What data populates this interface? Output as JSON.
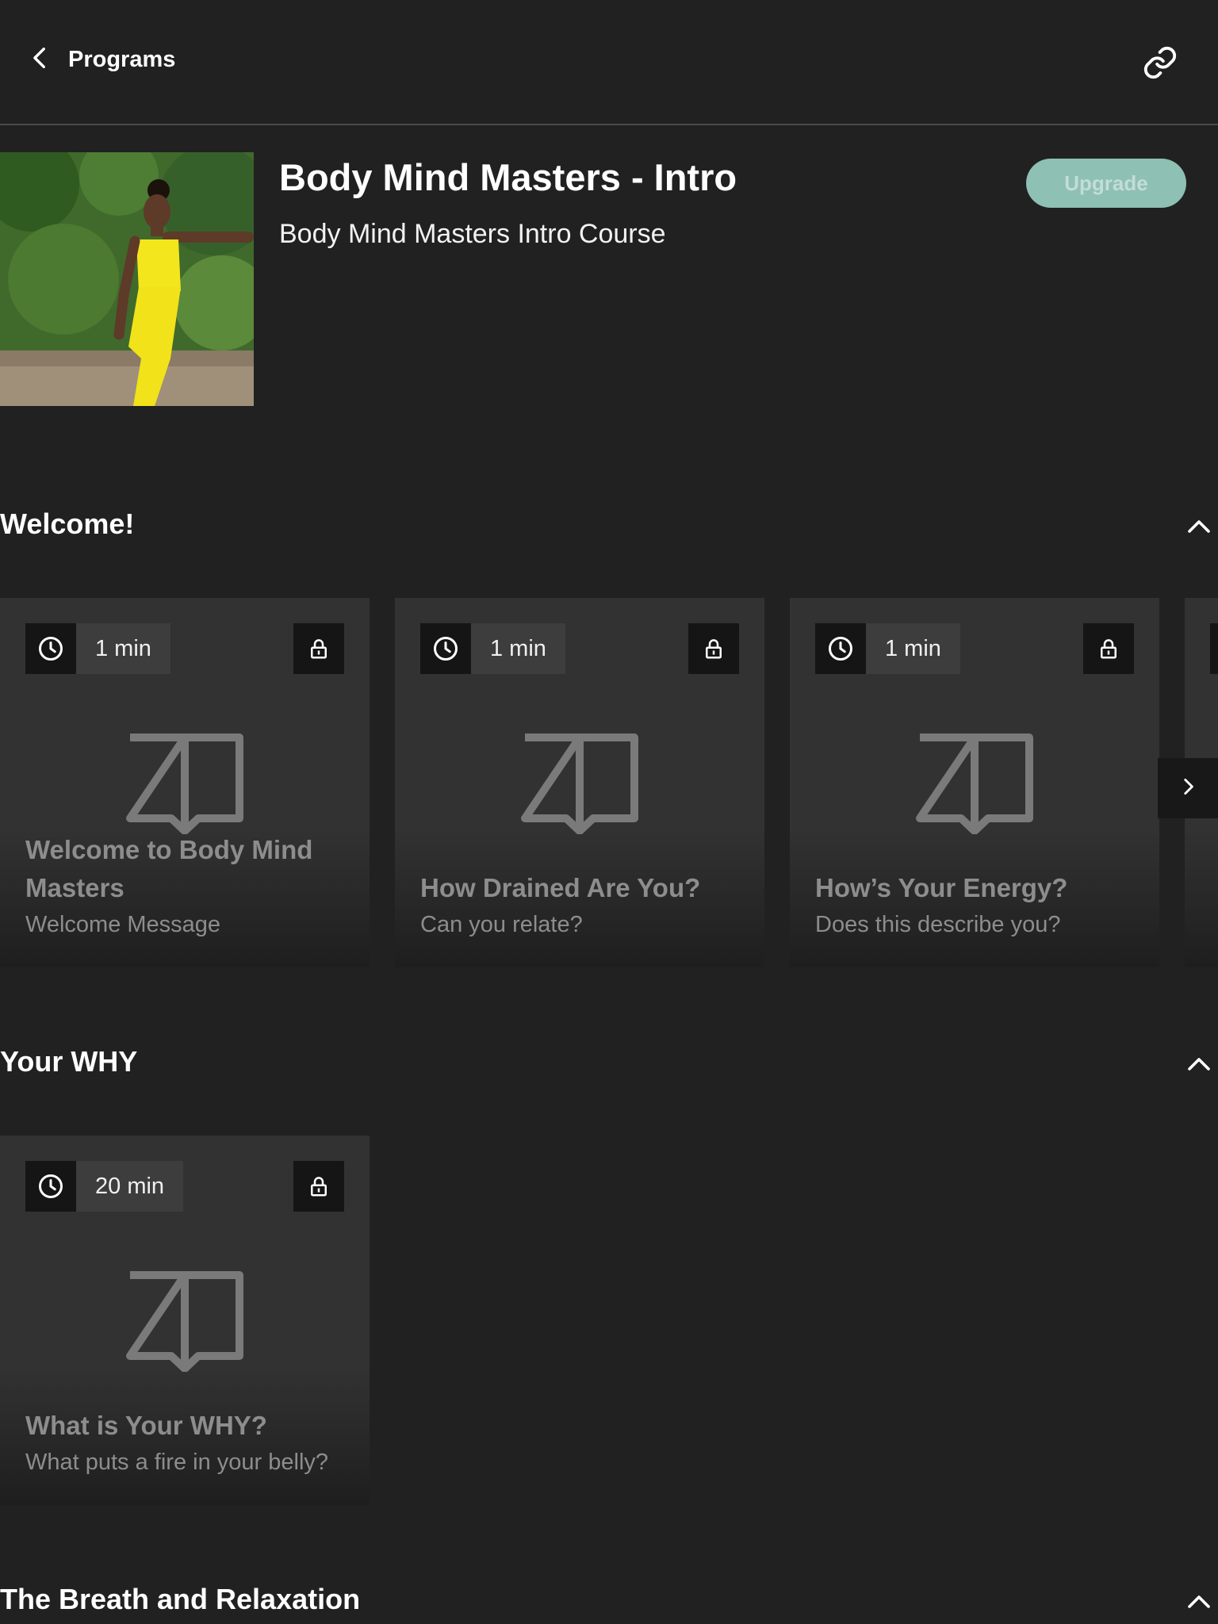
{
  "header": {
    "back_label": "Programs",
    "back_icon": "chevron-left-icon",
    "share_icon": "link-icon"
  },
  "program": {
    "title": "Body Mind Masters - Intro",
    "subtitle": "Body Mind Masters Intro Course",
    "upgrade_label": "Upgrade",
    "accent_color": "#8ec0b4"
  },
  "sections": [
    {
      "title": "Welcome!",
      "cards": [
        {
          "duration": "1 min",
          "title": "Welcome to Body Mind Masters",
          "subtitle": "Welcome Message"
        },
        {
          "duration": "1 min",
          "title": "How Drained Are You?",
          "subtitle": "Can you relate?"
        },
        {
          "duration": "1 min",
          "title": "How’s Your Energy?",
          "subtitle": "Does this describe you?"
        }
      ]
    },
    {
      "title": "Your WHY",
      "cards": [
        {
          "duration": "20 min",
          "title": "What is Your WHY?",
          "subtitle": "What puts a fire in your belly?"
        }
      ]
    },
    {
      "title": "The Breath and Relaxation",
      "cards": []
    }
  ]
}
